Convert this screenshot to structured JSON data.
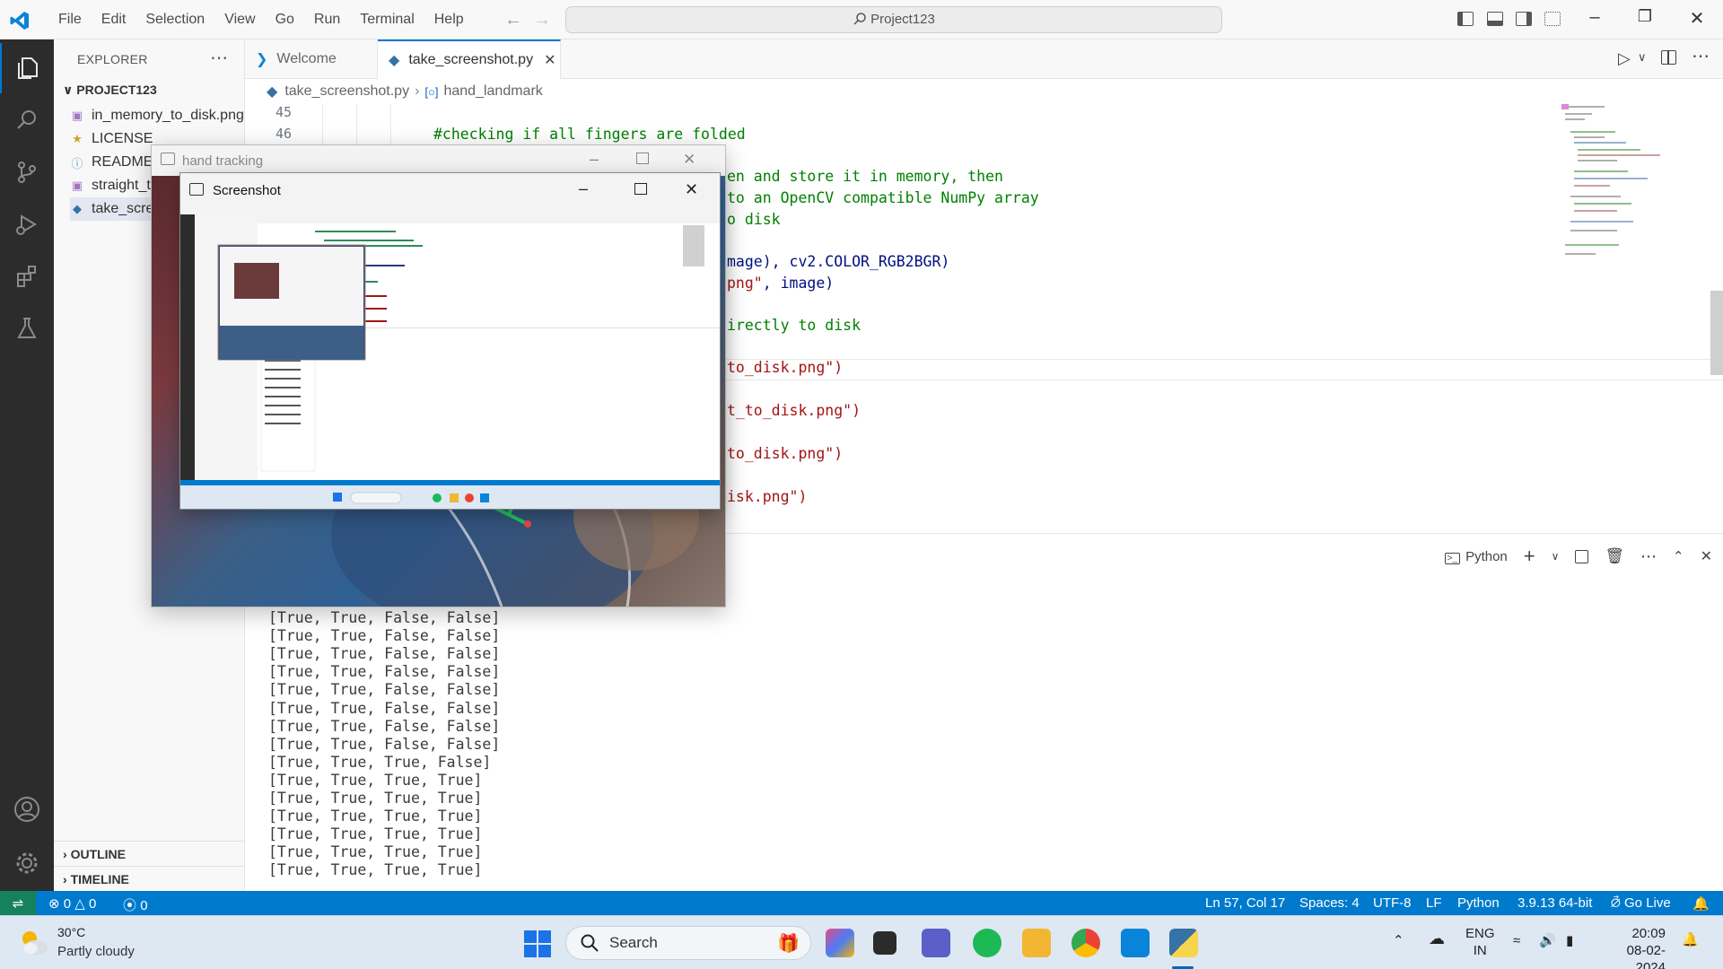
{
  "titlebar": {
    "menu": [
      "File",
      "Edit",
      "Selection",
      "View",
      "Go",
      "Run",
      "Terminal",
      "Help"
    ],
    "search": "Project123"
  },
  "sidebar": {
    "header": "EXPLORER",
    "project": "PROJECT123",
    "files": [
      {
        "name": "in_memory_to_disk.png",
        "icon": "image-file-icon"
      },
      {
        "name": "LICENSE",
        "icon": "license-file-icon"
      },
      {
        "name": "README.md",
        "icon": "info-file-icon"
      },
      {
        "name": "straight_to_disk.png",
        "icon": "image-file-icon"
      },
      {
        "name": "take_screenshot.py",
        "icon": "python-file-icon"
      }
    ],
    "outline": "OUTLINE",
    "timeline": "TIMELINE"
  },
  "tabs": [
    {
      "label": "Welcome",
      "active": false
    },
    {
      "label": "take_screenshot.py",
      "active": true
    }
  ],
  "breadcrumb": [
    "take_screenshot.py",
    "hand_landmark"
  ],
  "editor": {
    "line_numbers": [
      "45",
      "46"
    ],
    "comment_46": "#checking if all fingers are folded",
    "frag": {
      "l1": "en and store it in memory, then",
      "l2": "to an OpenCV compatible NumPy array",
      "l3": "o disk",
      "l4a": "mage), cv2.COLOR_RGB2BGR)",
      "l5a": "png\"",
      "l5b": ", image)",
      "l6": "irectly to disk",
      "l7": "to_disk.png\")",
      "l8": "t_to_disk.png\")",
      "l9": "to_disk.png\")",
      "l10": "isk.png\")"
    }
  },
  "terminal": {
    "profile": "Python",
    "lines": [
      "[True, True, False, False]",
      "[True, True, False, False]",
      "[True, True, False, False]",
      "[True, True, False, False]",
      "[True, True, False, False]",
      "[True, True, False, False]",
      "[True, True, False, False]",
      "[True, True, False, False]",
      "[True, True, True, False]",
      "[True, True, True, True]",
      "[True, True, True, True]",
      "[True, True, True, True]",
      "[True, True, True, True]",
      "[True, True, True, True]",
      "[True, True, True, True]"
    ]
  },
  "statusbar": {
    "errors": "0",
    "warnings": "0",
    "ports": "0",
    "position": "Ln 57, Col 17",
    "spaces": "Spaces: 4",
    "encoding": "UTF-8",
    "eol": "LF",
    "language": "Python",
    "interpreter": "3.9.13 64-bit",
    "golive": "Go Live"
  },
  "windows": {
    "hand_title": "hand tracking",
    "shot_title": "Screenshot"
  },
  "taskbar": {
    "temp": "30°C",
    "condition": "Partly cloudy",
    "search": "Search",
    "lang_top": "ENG",
    "lang_bottom": "IN",
    "time": "20:09",
    "date": "08-02-2024"
  },
  "colors": {
    "accent": "#0078d4",
    "statusbar": "#007acc",
    "remote": "#16825d",
    "activitybar": "#2c2c2c"
  }
}
